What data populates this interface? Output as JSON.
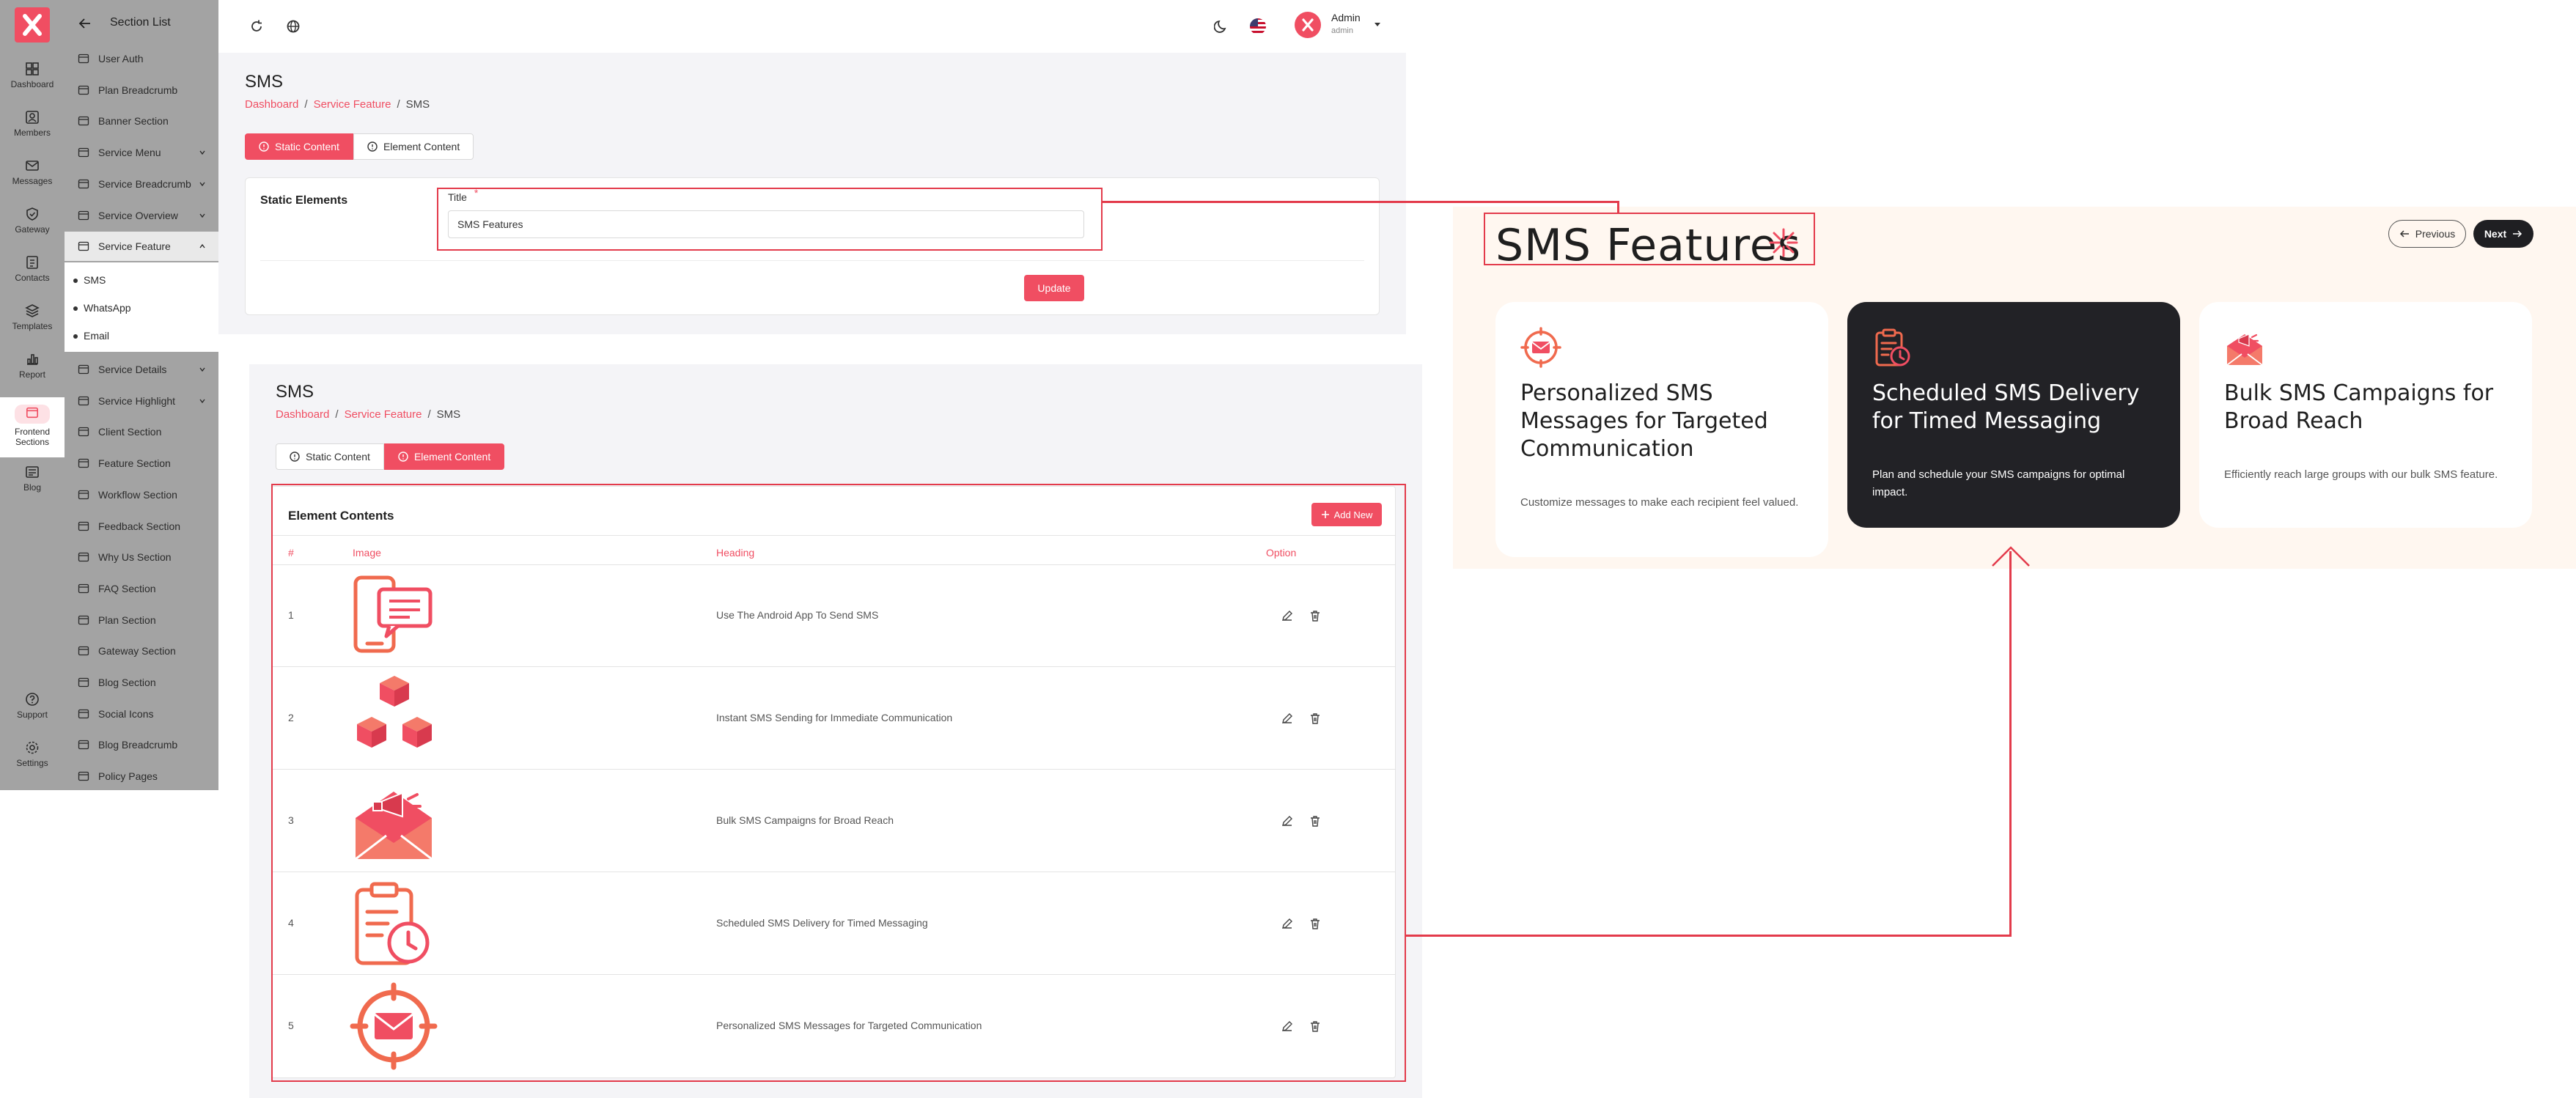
{
  "rail": {
    "items": [
      {
        "label": "Dashboard",
        "icon": "grid-icon"
      },
      {
        "label": "Members",
        "icon": "members-icon"
      },
      {
        "label": "Messages",
        "icon": "mail-icon"
      },
      {
        "label": "Gateway",
        "icon": "gateway-icon"
      },
      {
        "label": "Contacts",
        "icon": "contacts-icon"
      },
      {
        "label": "Templates",
        "icon": "layers-icon"
      },
      {
        "label": "Report",
        "icon": "report-icon"
      },
      {
        "label": "Frontend",
        "label2": "Sections",
        "icon": "frontend-icon"
      },
      {
        "label": "Blog",
        "icon": "blog-icon"
      }
    ],
    "bottom": [
      {
        "label": "Support",
        "icon": "support-icon"
      },
      {
        "label": "Settings",
        "icon": "settings-icon"
      }
    ]
  },
  "section_list": {
    "title": "Section List",
    "items": [
      {
        "label": "User Auth"
      },
      {
        "label": "Plan Breadcrumb"
      },
      {
        "label": "Banner Section"
      },
      {
        "label": "Service Menu"
      },
      {
        "label": "Service Breadcrumb"
      },
      {
        "label": "Service Overview"
      },
      {
        "label": "Service Feature"
      },
      {
        "label": "Service Details"
      },
      {
        "label": "Service Highlight"
      },
      {
        "label": "Client Section"
      },
      {
        "label": "Feature Section"
      },
      {
        "label": "Workflow Section"
      },
      {
        "label": "Feedback Section"
      },
      {
        "label": "Why Us Section"
      },
      {
        "label": "FAQ Section"
      },
      {
        "label": "Plan Section"
      },
      {
        "label": "Gateway Section"
      },
      {
        "label": "Blog Section"
      },
      {
        "label": "Social Icons"
      },
      {
        "label": "Blog Breadcrumb"
      },
      {
        "label": "Policy Pages"
      }
    ],
    "sub_items": [
      "SMS",
      "WhatsApp",
      "Email"
    ]
  },
  "topbar": {
    "user_name": "Admin",
    "user_role": "admin"
  },
  "panel1": {
    "title": "SMS",
    "breadcrumb": [
      "Dashboard",
      "Service Feature",
      "SMS"
    ],
    "tabs": [
      "Static Content",
      "Element Content"
    ],
    "card_label": "Static Elements",
    "field_label": "Title",
    "required_mark": "*",
    "field_value": "SMS Features",
    "update_label": "Update"
  },
  "panel2": {
    "title": "SMS",
    "breadcrumb": [
      "Dashboard",
      "Service Feature",
      "SMS"
    ],
    "tabs": [
      "Static Content",
      "Element Content"
    ],
    "card_title": "Element Contents",
    "add_label": "Add New",
    "columns": [
      "#",
      "Image",
      "Heading",
      "Option"
    ],
    "rows": [
      {
        "num": "1",
        "heading": "Use The Android App To Send SMS",
        "image": "phone-chat-icon"
      },
      {
        "num": "2",
        "heading": "Instant SMS Sending for Immediate Communication",
        "image": "cubes-icon"
      },
      {
        "num": "3",
        "heading": "Bulk SMS Campaigns for Broad Reach",
        "image": "megaphone-mail-icon"
      },
      {
        "num": "4",
        "heading": "Scheduled SMS Delivery for Timed Messaging",
        "image": "clipboard-clock-icon"
      },
      {
        "num": "5",
        "heading": "Personalized SMS Messages for Targeted Communication",
        "image": "target-mail-icon"
      }
    ]
  },
  "preview": {
    "title": "SMS Features",
    "prev_label": "Previous",
    "next_label": "Next",
    "cards": [
      {
        "heading": "Personalized SMS Messages for Targeted Communication",
        "desc": "Customize messages to make each recipient feel valued.",
        "icon": "target-mail-icon"
      },
      {
        "heading": "Scheduled SMS Delivery for Timed Messaging",
        "desc": "Plan and schedule your SMS campaigns for optimal impact.",
        "icon": "clipboard-clock-icon"
      },
      {
        "heading": "Bulk SMS Campaigns for Broad Reach",
        "desc": "Efficiently reach large groups with our bulk SMS feature.",
        "icon": "megaphone-mail-icon"
      }
    ]
  },
  "colors": {
    "accent": "#f04e62",
    "annotation": "#e33b4b",
    "sidebar": "#a3a3a3",
    "dark_card": "#222226",
    "preview_bg": "#fff7f0"
  }
}
